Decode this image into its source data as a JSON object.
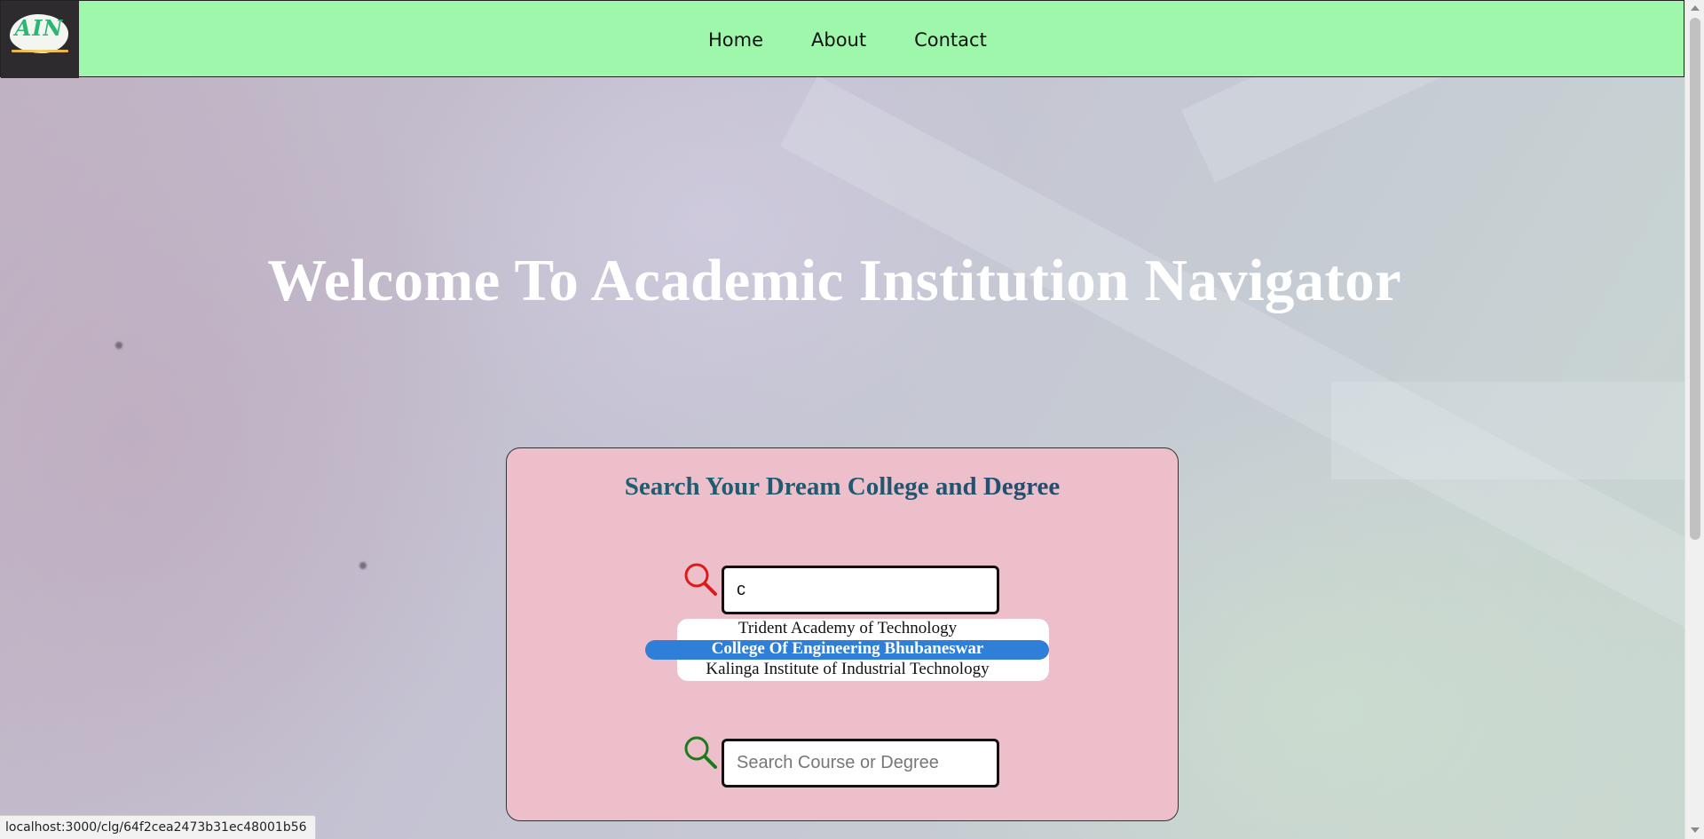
{
  "nav": {
    "logo_text": "AIN",
    "links": [
      "Home",
      "About",
      "Contact"
    ]
  },
  "hero": {
    "title": "Welcome To Academic Institution Navigator"
  },
  "search_card": {
    "title": "Search Your Dream College and Degree",
    "college_search": {
      "value": "c",
      "icon": "search-icon-red"
    },
    "suggestions": [
      "Trident Academy of Technology",
      "College Of Engineering Bhubaneswar",
      "Kalinga Institute of Industrial Technology"
    ],
    "active_suggestion_index": 1,
    "course_search": {
      "value": "",
      "placeholder": "Search Course or Degree",
      "icon": "search-icon-green"
    }
  },
  "status_bar": {
    "url": "localhost:3000/clg/64f2cea2473b31ec48001b56"
  },
  "colors": {
    "navbar": "#9ef7ab",
    "card": "#ecbfca",
    "highlight": "#2f7fd9",
    "icon_red": "#e01a1a",
    "icon_green": "#1c7a1c"
  }
}
